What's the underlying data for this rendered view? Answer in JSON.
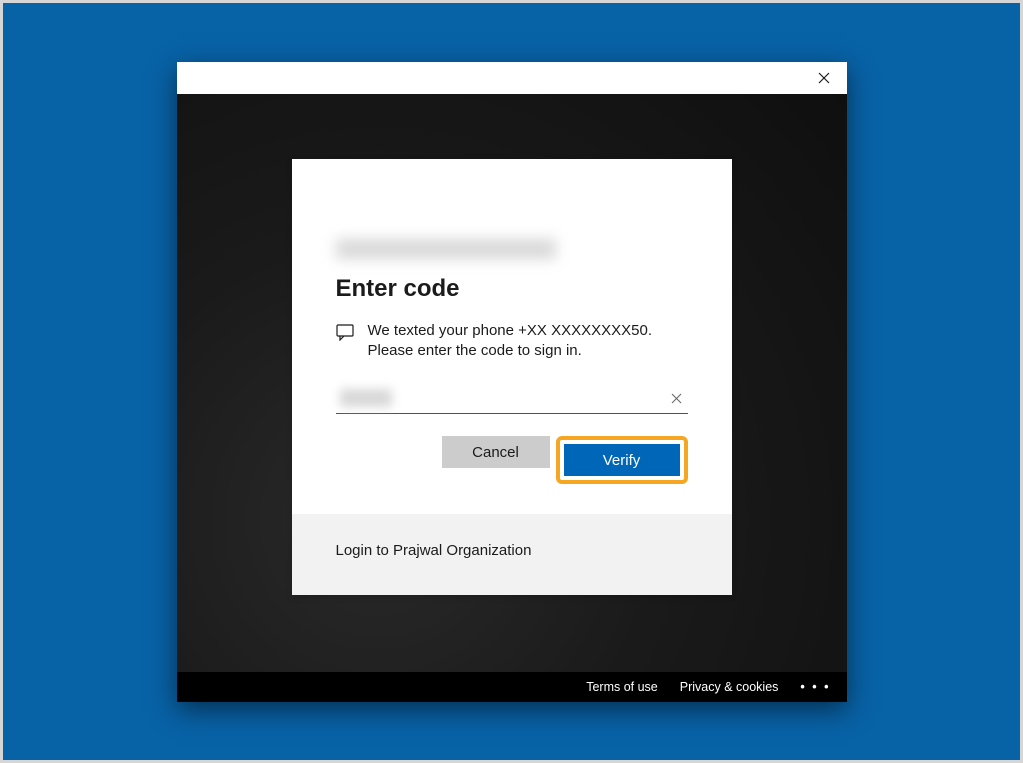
{
  "heading": "Enter code",
  "message": "We texted your phone +XX XXXXXXXX50. Please enter the code to sign in.",
  "buttons": {
    "cancel": "Cancel",
    "verify": "Verify"
  },
  "footer": {
    "org_login": "Login to Prajwal Organization"
  },
  "bottom": {
    "terms": "Terms of use",
    "privacy": "Privacy & cookies",
    "more": "• • •"
  }
}
